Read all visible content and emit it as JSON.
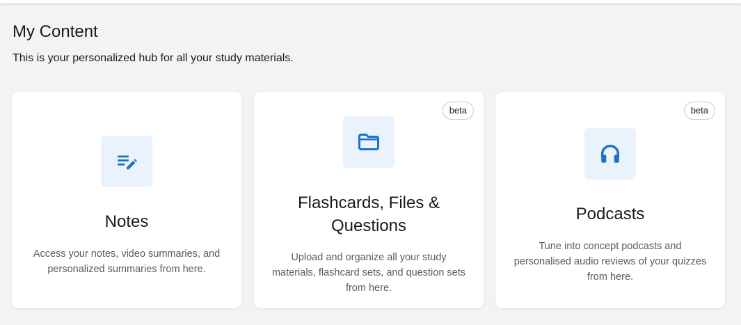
{
  "header": {
    "title": "My Content",
    "subtitle": "This is your personalized hub for all your study materials."
  },
  "cards": [
    {
      "title": "Notes",
      "description": "Access your notes, video summaries, and personalized summaries from here.",
      "icon": "notes-edit-icon",
      "badge": ""
    },
    {
      "title": "Flashcards, Files & Questions",
      "description": "Upload and organize all your study materials, flashcard sets, and question sets from here.",
      "icon": "folder-icon",
      "badge": "beta"
    },
    {
      "title": "Podcasts",
      "description": "Tune into concept podcasts and personalised audio reviews of your quizzes from here.",
      "icon": "headphones-icon",
      "badge": "beta"
    }
  ],
  "colors": {
    "background": "#f3f3f3",
    "card": "#ffffff",
    "icon_box": "#eaf2fb",
    "icon": "#1a73c8"
  }
}
